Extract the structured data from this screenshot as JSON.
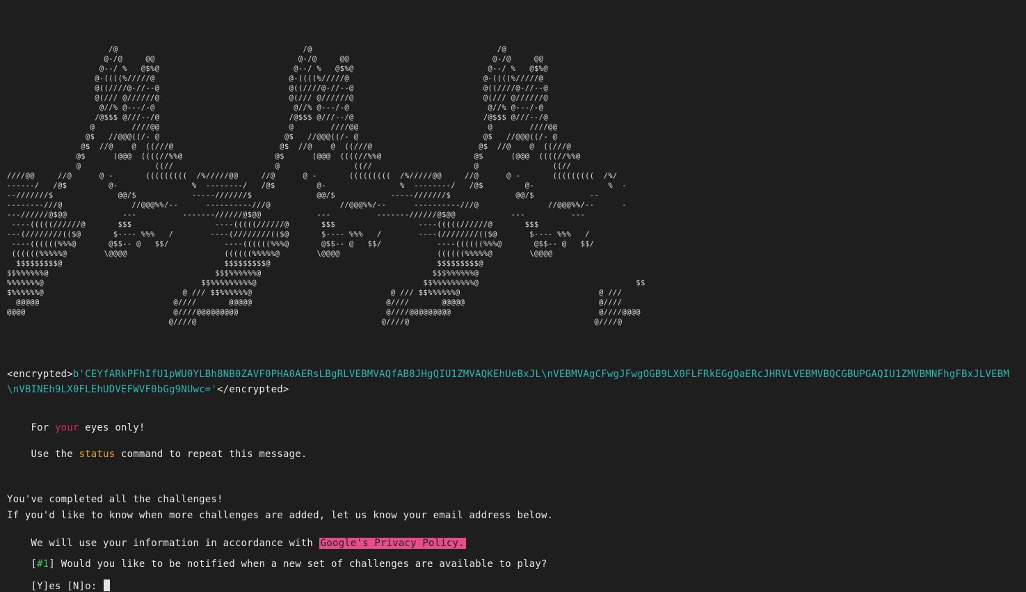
{
  "ascii_art": [
    "                      /@                                        /@                                        /@",
    "                     @-/@     @@                               @-/@     @@                               @-/@     @@",
    "                    @--/ %   @$%@                             @--/ %   @$%@                             @--/ %   @$%@",
    "                   @-((((%/////@                             @-((((%/////@                             @-((((%/////@",
    "                   @((////@-//--@                            @((////@-//--@                            @((////@-//--@",
    "                   @(/// @//////@                            @(/// @//////@                            @(/// @//////@",
    "                    @//% @---/-@                              @//% @---/-@                              @//% @---/-@",
    "                   /@$$$ @///--/@                            /@$$$ @///--/@                            /@$$$ @///--/@",
    "                  @        ////@@                            @        ////@@                            @        ////@@",
    "                 @$   //@@@((/- @                           @$   //@@@((/- @                           @$   //@@@((/- @",
    "                @$  //@    @  ((///@                       @$  //@    @  ((///@                       @$  //@    @  ((///@",
    "               @$      (@@@  ((((//%%@                    @$      (@@@  ((((//%%@                    @$      (@@@  ((((//%%@",
    "               @                ((//                      @                ((//                      @                ((//",
    "////@@     //@      @ -       (((((((((  /%/////@@     //@      @ -       (((((((((  /%/////@@     //@      @ -       (((((((((  /%/",
    "------/   /@$         @-                %  --------/   /@$         @-                %  --------/   /@$         @-                %  -",
    "--///////$              @@/$            -----///////$              @@/$            -----///////$              @@/$            --",
    "--------///@               //@@@%%/--      ----------///@               //@@@%%/--      ----------///@               //@@@%%/--      -",
    "---//////@$@@            ---          -------//////@$@@            ---          -------//////@$@@            ---          ---",
    " ----(((((//////@       $$$                  ----(((((//////@       $$$                  ----(((((//////@       $$$",
    "---(////////(($@       $---- %%%   /        ----(////////(($@       $---- %%%   /        ----(////////(($@       $---- %%%   /",
    " ----((((((%%%@       @$$-- @   $$/            ----((((((%%%@       @$$-- @   $$/            ----((((((%%%@       @$$-- @   $$/",
    " ((((((%%%%%@        \\@@@@                     ((((((%%%%%@        \\@@@@                     ((((((%%%%%@        \\@@@@",
    "  $$$$$$$$$@                                   $$$$$$$$$@                                    $$$$$$$$$@",
    "$$%%%%%%@                                    $$$%%%%%%@                                     $$$%%%%%%@",
    "%%%%%%%@                                  $$%%%%%%%%%@                                    $$%%%%%%%%%@                                  $$",
    "$%%%%%%@                              @ /// $$%%%%%%@                              @ /// $$%%%%%%@                              @ ///",
    "  @@@@@                             @////       @@@@@                             @////       @@@@@                             @////",
    "@@@@                                @////@@@@@@@@@                                @////@@@@@@@@@                                @////@@@@",
    "                                   @////@                                        @////@                                        @////@"
  ],
  "encrypted": {
    "open_tag": "<encrypted>",
    "value": "b'CEYfARkPFhIfU1pWU0YLBh8NB0ZAVF0PHA0AERsLBgRLVEBMVAQfAB8JHgQIU1ZMVAQKEhUeBxJL\\nVEBMVAgCFwgJFwgOGB9LX0FLFRkEGgQaERcJHRVLVEBMVBQCGBUPGAQIU1ZMVBMNFhgFBxJLVEBM\\nVBINEh9LX0FLEhUDVEFWVF0bGg9NUwc='",
    "close_tag": "</encrypted>"
  },
  "eyes_only": {
    "before": "For ",
    "highlight": "your",
    "after": " eyes only!"
  },
  "status_hint": {
    "before": "Use the ",
    "command": "status",
    "after": " command to repeat this message."
  },
  "completed_line": "You've completed all the challenges!",
  "notify_line": "If you'd like to know when more challenges are added, let us know your email address below.",
  "policy_line": {
    "before": "We will use your information in accordance with ",
    "link": "Google's Privacy Policy."
  },
  "question": {
    "open_bracket": "[",
    "number": "#1",
    "close_bracket": "]",
    "text": " Would you like to be notified when a new set of challenges are available to play?"
  },
  "prompt": "[Y]es [N]o: ",
  "colors": {
    "background": "#1e1e1e",
    "foreground": "#e6e6e6",
    "teal": "#2fb6b0",
    "red": "#e0245a",
    "orange": "#f0a030",
    "green": "#3cc45a",
    "link_background": "#e84d8a"
  }
}
